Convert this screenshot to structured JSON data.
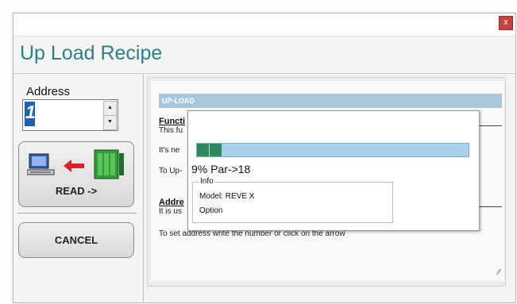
{
  "window": {
    "close_label": "x",
    "title": "Up Load Recipe"
  },
  "left_panel": {
    "address_label": "Address",
    "address_value": "1",
    "read_button_label": "READ ->",
    "cancel_button_label": "CANCEL"
  },
  "doc": {
    "band_title": "UP-LOAD",
    "section1_heading": "Functi",
    "line1": "This fu",
    "line2": "It's ne",
    "line3": "To Up-",
    "section2_heading": "Addre",
    "line4": "It is us",
    "line5": "To set address write the number or click on the arrow"
  },
  "progress_dialog": {
    "percent": 9,
    "status_text": "9% Par->18",
    "info_title": "Info",
    "model_text": "Model: REVE X",
    "option_text": "Option"
  },
  "colors": {
    "title": "#2c7f86",
    "band": "#a8c6dc",
    "progress_fill": "#2c8a5c",
    "close_button": "#c8413b"
  }
}
